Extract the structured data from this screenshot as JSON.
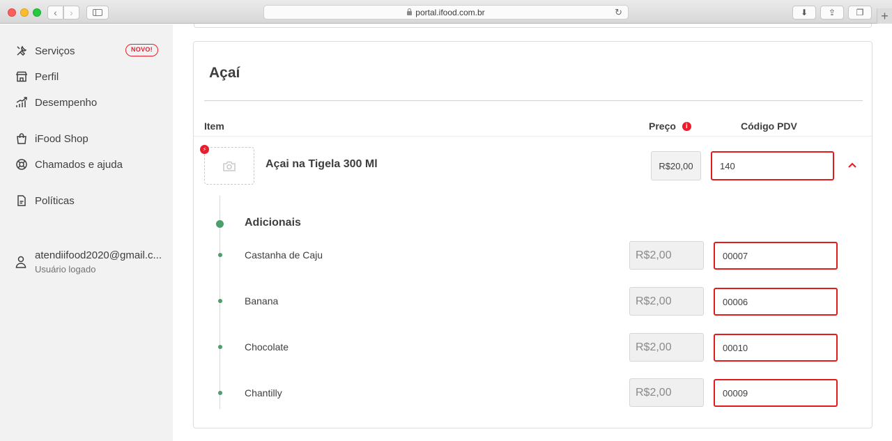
{
  "browser": {
    "url": "portal.ifood.com.br"
  },
  "sidebar": {
    "items": [
      {
        "label": "Serviços",
        "icon": "tools-icon"
      },
      {
        "label": "Perfil",
        "icon": "store-icon"
      },
      {
        "label": "Desempenho",
        "icon": "chart-icon"
      },
      {
        "label": "iFood Shop",
        "icon": "shopping-bag-icon"
      },
      {
        "label": "Chamados e ajuda",
        "icon": "lifebuoy-icon"
      },
      {
        "label": "Políticas",
        "icon": "document-icon"
      }
    ],
    "badge": "NOVO!",
    "user": {
      "email": "atendiifood2020@gmail.c...",
      "status": "Usuário logado"
    }
  },
  "card": {
    "title": "Açaí",
    "columns": {
      "item": "Item",
      "preco": "Preço",
      "codigo_pdv": "Código PDV"
    },
    "item": {
      "name": "Açai na Tigela 300 Ml",
      "price": "R$20,00",
      "pdv": "140"
    },
    "group_title": "Adicionais",
    "addons": [
      {
        "name": "Castanha de Caju",
        "price": "R$2,00",
        "pdv": "00007"
      },
      {
        "name": "Banana",
        "price": "R$2,00",
        "pdv": "00006"
      },
      {
        "name": "Chocolate",
        "price": "R$2,00",
        "pdv": "00010"
      },
      {
        "name": "Chantilly",
        "price": "R$2,00",
        "pdv": "00009"
      }
    ]
  },
  "colors": {
    "brand_red": "#ea1d2c",
    "input_border": "#e01c1c",
    "tree_green": "#4c9e6b"
  }
}
